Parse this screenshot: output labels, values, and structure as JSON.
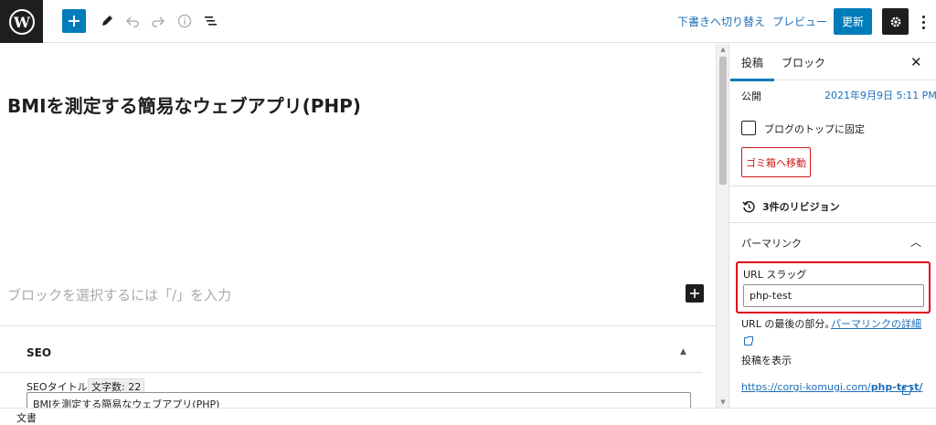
{
  "toolbar": {
    "logo_icon": "wordpress-logo",
    "add_icon": "plus-icon",
    "tools": [
      {
        "name": "edit-tool-icon"
      },
      {
        "name": "undo-icon"
      },
      {
        "name": "redo-icon"
      },
      {
        "name": "info-icon"
      },
      {
        "name": "list-view-icon"
      }
    ],
    "switch_to_draft": "下書きへ切り替え",
    "preview": "プレビュー",
    "update": "更新",
    "accent_color": "#007cba"
  },
  "editor": {
    "post_title": "BMIを測定する簡易なウェブアプリ(PHP)",
    "block_placeholder": "ブロックを選択するには「/」を入力"
  },
  "seo": {
    "heading": "SEO",
    "title_label": "SEOタイトル",
    "char_count": "文字数: 22",
    "title_value": "BMIを測定する簡易なウェブアプリ(PHP)"
  },
  "sidebar": {
    "tabs": [
      "投稿",
      "ブロック"
    ],
    "publish_label": "公開",
    "publish_date": "2021年9月9日 5:11 PM",
    "sticky_label": "ブログのトップに固定",
    "trash_label": "ゴミ箱へ移動",
    "revisions_label": "3件のリビジョン",
    "permalink_heading": "パーマリンク",
    "slug_label": "URL スラッグ",
    "slug_value": "php-test",
    "url_last_part": "URL の最後の部分。",
    "permalink_detail_link": "パーマリンクの詳細",
    "view_post_label": "投稿を表示",
    "view_post_url_prefix": "https://corgi-komugi.com/",
    "view_post_url_slug": "php-test/",
    "highlight_color": "#e0001a"
  },
  "statusbar": {
    "breadcrumb": "文書"
  }
}
